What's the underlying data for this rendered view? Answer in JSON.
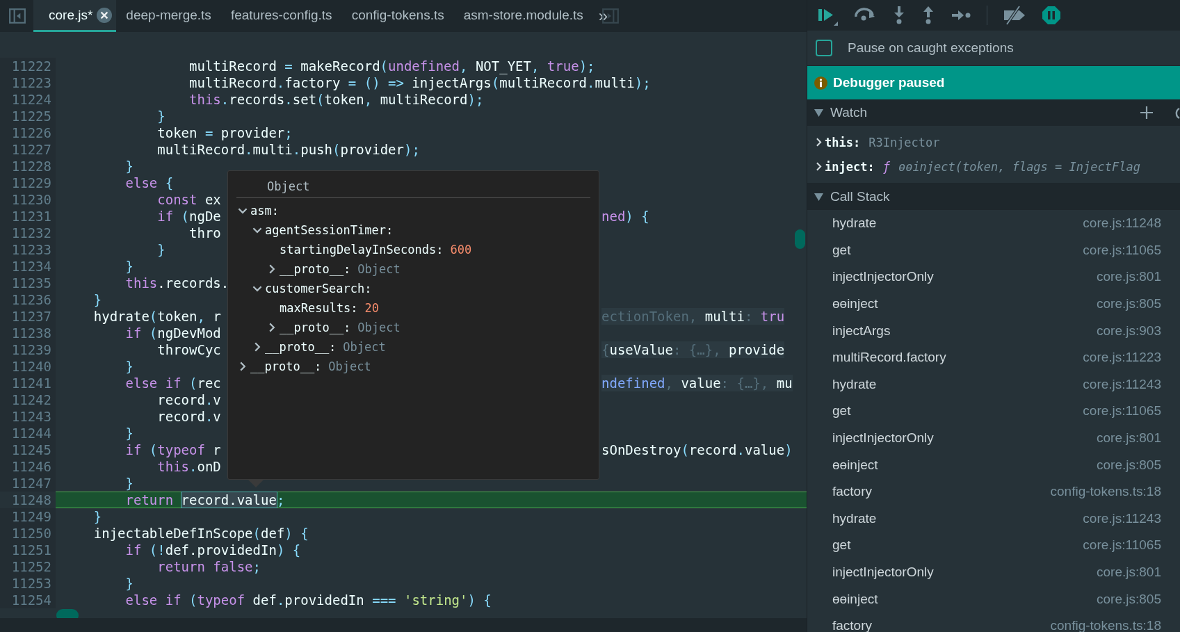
{
  "tabs": [
    {
      "label": "core.js*",
      "selected": true
    },
    {
      "label": "deep-merge.ts",
      "selected": false
    },
    {
      "label": "features-config.ts",
      "selected": false
    },
    {
      "label": "config-tokens.ts",
      "selected": false
    },
    {
      "label": "asm-store.module.ts",
      "selected": false
    }
  ],
  "tabs_overflow": "»",
  "code_lines": [
    {
      "number": "11222",
      "current": false,
      "tokens": [
        {
          "text": "                multiRecord ",
          "kind": "id"
        },
        {
          "text": "=",
          "kind": "pu"
        },
        {
          "text": " makeRecord",
          "kind": "id"
        },
        {
          "text": "(",
          "kind": "pu"
        },
        {
          "text": "undefined",
          "kind": "kw"
        },
        {
          "text": ", ",
          "kind": "pu"
        },
        {
          "text": "NOT_YET",
          "kind": "id"
        },
        {
          "text": ", ",
          "kind": "pu"
        },
        {
          "text": "true",
          "kind": "kw"
        },
        {
          "text": ");",
          "kind": "pu"
        }
      ]
    },
    {
      "number": "11223",
      "current": false,
      "tokens": [
        {
          "text": "                multiRecord",
          "kind": "id"
        },
        {
          "text": ".",
          "kind": "pu"
        },
        {
          "text": "factory ",
          "kind": "id"
        },
        {
          "text": "= () =>",
          "kind": "pu"
        },
        {
          "text": " injectArgs",
          "kind": "id"
        },
        {
          "text": "(",
          "kind": "pu"
        },
        {
          "text": "multiRecord",
          "kind": "id"
        },
        {
          "text": ".",
          "kind": "pu"
        },
        {
          "text": "multi",
          "kind": "id"
        },
        {
          "text": ");",
          "kind": "pu"
        }
      ]
    },
    {
      "number": "11224",
      "current": false,
      "tokens": [
        {
          "text": "                this",
          "kind": "kw"
        },
        {
          "text": ".",
          "kind": "pu"
        },
        {
          "text": "records",
          "kind": "id"
        },
        {
          "text": ".",
          "kind": "pu"
        },
        {
          "text": "set",
          "kind": "id"
        },
        {
          "text": "(",
          "kind": "pu"
        },
        {
          "text": "token",
          "kind": "id"
        },
        {
          "text": ", ",
          "kind": "pu"
        },
        {
          "text": "multiRecord",
          "kind": "id"
        },
        {
          "text": ");",
          "kind": "pu"
        }
      ]
    },
    {
      "number": "11225",
      "current": false,
      "tokens": [
        {
          "text": "            }",
          "kind": "pu"
        }
      ]
    },
    {
      "number": "11226",
      "current": false,
      "tokens": [
        {
          "text": "            token ",
          "kind": "id"
        },
        {
          "text": "=",
          "kind": "pu"
        },
        {
          "text": " provider",
          "kind": "id"
        },
        {
          "text": ";",
          "kind": "pu"
        }
      ]
    },
    {
      "number": "11227",
      "current": false,
      "tokens": [
        {
          "text": "            multiRecord",
          "kind": "id"
        },
        {
          "text": ".",
          "kind": "pu"
        },
        {
          "text": "multi",
          "kind": "id"
        },
        {
          "text": ".",
          "kind": "pu"
        },
        {
          "text": "push",
          "kind": "id"
        },
        {
          "text": "(",
          "kind": "pu"
        },
        {
          "text": "provider",
          "kind": "id"
        },
        {
          "text": ");",
          "kind": "pu"
        }
      ]
    },
    {
      "number": "11228",
      "current": false,
      "tokens": [
        {
          "text": "        }",
          "kind": "pu"
        }
      ]
    },
    {
      "number": "11229",
      "current": false,
      "tokens": [
        {
          "text": "        else",
          "kind": "kw"
        },
        {
          "text": " {",
          "kind": "pu"
        }
      ]
    },
    {
      "number": "11230",
      "current": false,
      "tokens": [
        {
          "text": "            const",
          "kind": "kw"
        },
        {
          "text": " ex",
          "kind": "id"
        }
      ]
    },
    {
      "number": "11231",
      "current": false,
      "tokens": [
        {
          "text": "            if",
          "kind": "kw"
        },
        {
          "text": " (",
          "kind": "pu"
        },
        {
          "text": "ngDe",
          "kind": "id"
        }
      ],
      "right": {
        "kind": "code",
        "tokens": [
          {
            "text": "ned",
            "kind": "kw"
          },
          {
            "text": ") {",
            "kind": "pu"
          }
        ]
      }
    },
    {
      "number": "11232",
      "current": false,
      "tokens": [
        {
          "text": "                thro",
          "kind": "id"
        }
      ]
    },
    {
      "number": "11233",
      "current": false,
      "tokens": [
        {
          "text": "            }",
          "kind": "pu"
        }
      ]
    },
    {
      "number": "11234",
      "current": false,
      "tokens": [
        {
          "text": "        }",
          "kind": "pu"
        }
      ]
    },
    {
      "number": "11235",
      "current": false,
      "tokens": [
        {
          "text": "        this",
          "kind": "kw"
        },
        {
          "text": ".records.",
          "kind": "id"
        }
      ]
    },
    {
      "number": "11236",
      "current": false,
      "tokens": [
        {
          "text": "    }",
          "kind": "pu"
        }
      ]
    },
    {
      "number": "11237",
      "current": false,
      "tokens": [
        {
          "text": "    hydrate",
          "kind": "id"
        },
        {
          "text": "(",
          "kind": "pu"
        },
        {
          "text": "token",
          "kind": "id"
        },
        {
          "text": ", ",
          "kind": "pu"
        },
        {
          "text": "r",
          "kind": "id"
        }
      ],
      "right": {
        "kind": "preview",
        "tokens": [
          {
            "text": "ectionToken, ",
            "kind": "dim"
          },
          {
            "text": "multi",
            "kind": "id"
          },
          {
            "text": ": ",
            "kind": "dim"
          },
          {
            "text": "tru",
            "kind": "kw"
          }
        ]
      }
    },
    {
      "number": "11238",
      "current": false,
      "tokens": [
        {
          "text": "        if",
          "kind": "kw"
        },
        {
          "text": " (",
          "kind": "pu"
        },
        {
          "text": "ngDevMod",
          "kind": "id"
        }
      ]
    },
    {
      "number": "11239",
      "current": false,
      "tokens": [
        {
          "text": "            throwCyc",
          "kind": "id"
        }
      ],
      "right": {
        "kind": "preview",
        "tokens": [
          {
            "text": "{",
            "kind": "dim"
          },
          {
            "text": "useValue",
            "kind": "id"
          },
          {
            "text": ": {…}, ",
            "kind": "dim"
          },
          {
            "text": "provide",
            "kind": "id"
          }
        ]
      }
    },
    {
      "number": "11240",
      "current": false,
      "tokens": [
        {
          "text": "        }",
          "kind": "pu"
        }
      ]
    },
    {
      "number": "11241",
      "current": false,
      "tokens": [
        {
          "text": "        else if",
          "kind": "kw"
        },
        {
          "text": " (",
          "kind": "pu"
        },
        {
          "text": "rec",
          "kind": "id"
        }
      ],
      "right": {
        "kind": "preview",
        "tokens": [
          {
            "text": "ndefined",
            "kind": "blue"
          },
          {
            "text": ", ",
            "kind": "dim"
          },
          {
            "text": "value",
            "kind": "id"
          },
          {
            "text": ": {…}, ",
            "kind": "dim"
          },
          {
            "text": "mu",
            "kind": "id"
          }
        ]
      }
    },
    {
      "number": "11242",
      "current": false,
      "tokens": [
        {
          "text": "            record",
          "kind": "id"
        },
        {
          "text": ".",
          "kind": "pu"
        },
        {
          "text": "v",
          "kind": "id"
        }
      ]
    },
    {
      "number": "11243",
      "current": false,
      "tokens": [
        {
          "text": "            record",
          "kind": "id"
        },
        {
          "text": ".",
          "kind": "pu"
        },
        {
          "text": "v",
          "kind": "id"
        }
      ]
    },
    {
      "number": "11244",
      "current": false,
      "tokens": [
        {
          "text": "        }",
          "kind": "pu"
        }
      ]
    },
    {
      "number": "11245",
      "current": false,
      "tokens": [
        {
          "text": "        if",
          "kind": "kw"
        },
        {
          "text": " (",
          "kind": "pu"
        },
        {
          "text": "typeof",
          "kind": "kw"
        },
        {
          "text": " r",
          "kind": "id"
        }
      ],
      "right": {
        "kind": "code",
        "tokens": [
          {
            "text": "sOnDestroy",
            "kind": "id"
          },
          {
            "text": "(",
            "kind": "pu"
          },
          {
            "text": "record",
            "kind": "id"
          },
          {
            "text": ".",
            "kind": "pu"
          },
          {
            "text": "value",
            "kind": "id"
          },
          {
            "text": ")",
            "kind": "pu"
          }
        ]
      }
    },
    {
      "number": "11246",
      "current": false,
      "tokens": [
        {
          "text": "            this",
          "kind": "kw"
        },
        {
          "text": ".",
          "kind": "pu"
        },
        {
          "text": "onD",
          "kind": "id"
        }
      ]
    },
    {
      "number": "11247",
      "current": false,
      "tokens": [
        {
          "text": "        }",
          "kind": "pu"
        }
      ]
    },
    {
      "number": "11248",
      "current": true,
      "tokens": [
        {
          "text": "        return ",
          "kind": "kw"
        },
        {
          "text": "record.value",
          "kind": "sel"
        },
        {
          "text": ";",
          "kind": "pu"
        }
      ]
    },
    {
      "number": "11249",
      "current": false,
      "tokens": [
        {
          "text": "    }",
          "kind": "pu"
        }
      ]
    },
    {
      "number": "11250",
      "current": false,
      "tokens": [
        {
          "text": "    injectableDefInScope",
          "kind": "id"
        },
        {
          "text": "(",
          "kind": "pu"
        },
        {
          "text": "def",
          "kind": "id"
        },
        {
          "text": ") {",
          "kind": "pu"
        }
      ]
    },
    {
      "number": "11251",
      "current": false,
      "tokens": [
        {
          "text": "        if",
          "kind": "kw"
        },
        {
          "text": " (!",
          "kind": "pu"
        },
        {
          "text": "def.providedIn",
          "kind": "id"
        },
        {
          "text": ") {",
          "kind": "pu"
        }
      ]
    },
    {
      "number": "11252",
      "current": false,
      "tokens": [
        {
          "text": "            return false",
          "kind": "kw"
        },
        {
          "text": ";",
          "kind": "pu"
        }
      ]
    },
    {
      "number": "11253",
      "current": false,
      "tokens": [
        {
          "text": "        }",
          "kind": "pu"
        }
      ]
    },
    {
      "number": "11254",
      "current": false,
      "tokens": [
        {
          "text": "        else if",
          "kind": "kw"
        },
        {
          "text": " (",
          "kind": "pu"
        },
        {
          "text": "typeof",
          "kind": "kw"
        },
        {
          "text": " def",
          "kind": "id"
        },
        {
          "text": ".",
          "kind": "pu"
        },
        {
          "text": "providedIn ",
          "kind": "id"
        },
        {
          "text": "===",
          "kind": "pu"
        },
        {
          "text": " 'string'",
          "kind": "str"
        },
        {
          "text": ") {",
          "kind": "pu"
        }
      ]
    }
  ],
  "popup": {
    "title": "Object",
    "tree": [
      {
        "key": "asm:",
        "kind": "group",
        "expanded": true,
        "children": [
          {
            "key": "agentSessionTimer:",
            "kind": "group",
            "expanded": true,
            "children": [
              {
                "key": "startingDelayInSeconds:",
                "kind": "number",
                "value": "600"
              },
              {
                "key": "__proto__:",
                "kind": "group",
                "expanded": false,
                "value": "Object"
              }
            ]
          },
          {
            "key": "customerSearch:",
            "kind": "group",
            "expanded": true,
            "children": [
              {
                "key": "maxResults:",
                "kind": "number",
                "value": "20"
              },
              {
                "key": "__proto__:",
                "kind": "group",
                "expanded": false,
                "value": "Object"
              }
            ]
          },
          {
            "key": "__proto__:",
            "kind": "group",
            "expanded": false,
            "value": "Object"
          }
        ]
      },
      {
        "key": "__proto__:",
        "kind": "group",
        "expanded": false,
        "value": "Object"
      }
    ]
  },
  "pause_on_caught": {
    "label": "Pause on caught exceptions",
    "checked": false
  },
  "banner": "Debugger paused",
  "watch": {
    "title": "Watch",
    "expanded": true,
    "items": [
      {
        "name": "this:",
        "kind": "object",
        "value": "R3Injector",
        "expanded": false
      },
      {
        "name": "inject:",
        "kind": "function",
        "fn": "ƒ",
        "value": "ɵɵinject(token, flags = InjectFlag",
        "expanded": false
      }
    ]
  },
  "call_stack": {
    "title": "Call Stack",
    "expanded": true,
    "frames": [
      {
        "name": "hydrate",
        "location": "core.js:11248"
      },
      {
        "name": "get",
        "location": "core.js:11065"
      },
      {
        "name": "injectInjectorOnly",
        "location": "core.js:801"
      },
      {
        "name": "ɵɵinject",
        "location": "core.js:805"
      },
      {
        "name": "injectArgs",
        "location": "core.js:903"
      },
      {
        "name": "multiRecord.factory",
        "location": "core.js:11223"
      },
      {
        "name": "hydrate",
        "location": "core.js:11243"
      },
      {
        "name": "get",
        "location": "core.js:11065"
      },
      {
        "name": "injectInjectorOnly",
        "location": "core.js:801"
      },
      {
        "name": "ɵɵinject",
        "location": "core.js:805"
      },
      {
        "name": "factory",
        "location": "config-tokens.ts:18"
      },
      {
        "name": "hydrate",
        "location": "core.js:11243"
      },
      {
        "name": "get",
        "location": "core.js:11065"
      },
      {
        "name": "injectInjectorOnly",
        "location": "core.js:801"
      },
      {
        "name": "ɵɵinject",
        "location": "core.js:805"
      },
      {
        "name": "factory",
        "location": "config-tokens.ts:18"
      }
    ]
  }
}
